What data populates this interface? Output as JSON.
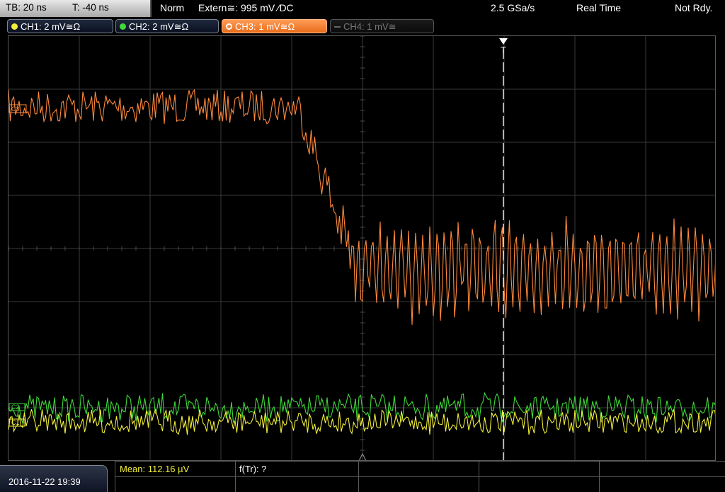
{
  "header": {
    "timebase": "TB: 20 ns",
    "trigger_offset": "T: -40 ns",
    "mode": "Norm",
    "trigger_source": "Extern≅: 995 mV ⁄DC",
    "sample_rate": "2.5 GSa/s",
    "acquisition": "Real Time",
    "status": "Not Rdy."
  },
  "channels": [
    {
      "label": "CH1: 2 mV≅Ω",
      "color": "#f2ef3a",
      "active": false
    },
    {
      "label": "CH2: 2 mV≅Ω",
      "color": "#3fd83a",
      "active": false
    },
    {
      "label": "CH3: 1 mV≅Ω",
      "color": "#ff8a3d",
      "active": true
    },
    {
      "label": "CH4: 1 mV≅",
      "color": "#777777",
      "active": false
    }
  ],
  "markers": {
    "trigger_marker": "T",
    "ch3_ref": "C3",
    "ch2_ref": "C2",
    "ch1_ref": "C1"
  },
  "footer": {
    "datetime": "2016-11-22 19:39",
    "mean_measure": "Mean: 112.16 µV",
    "rise_measure": "f(Tr): ?"
  }
}
